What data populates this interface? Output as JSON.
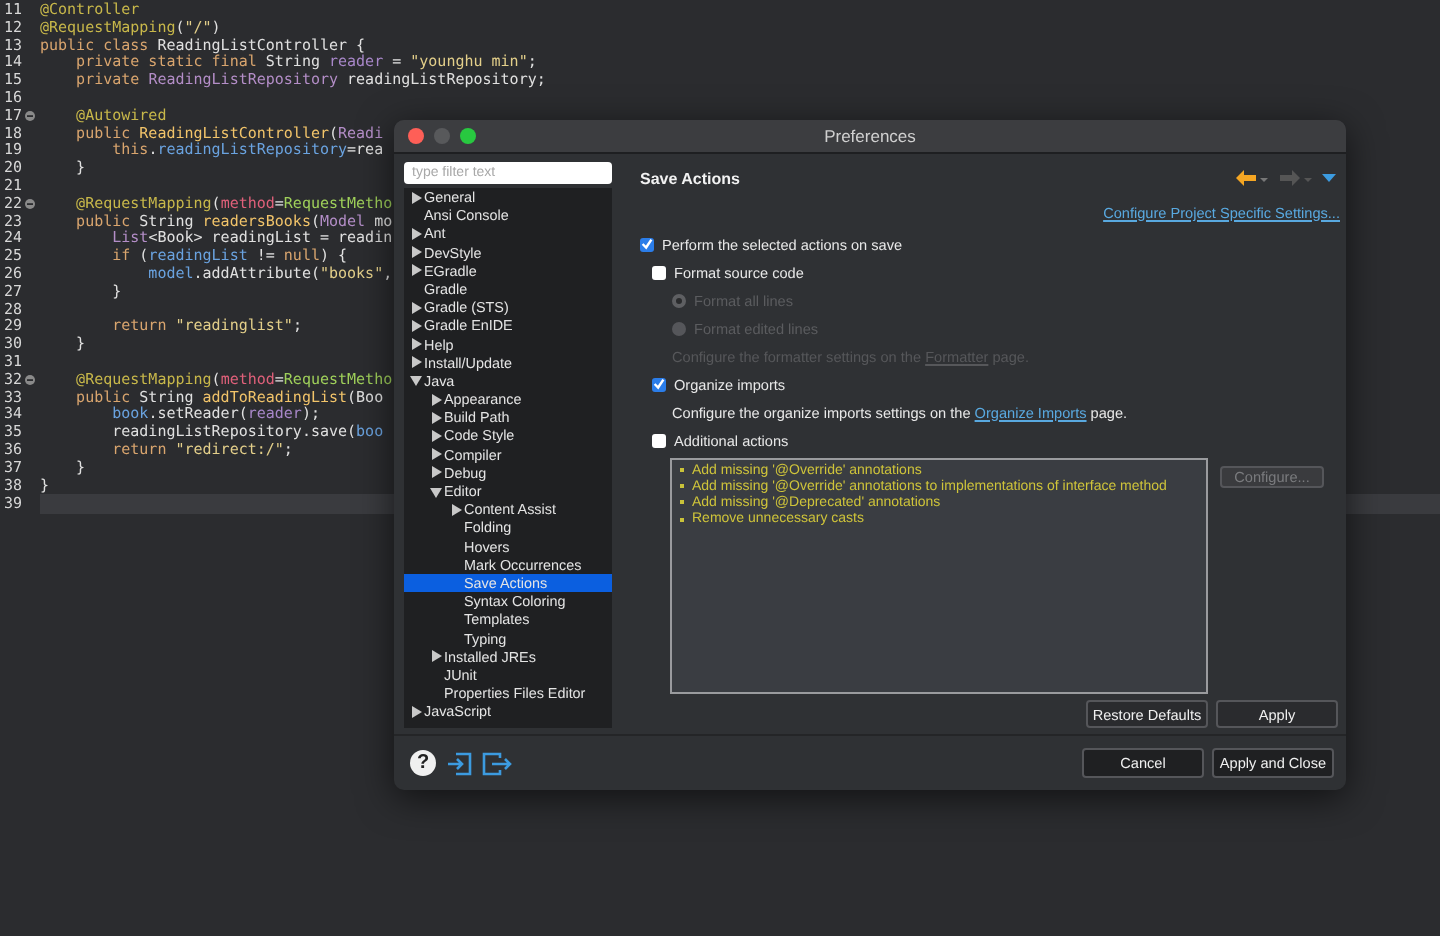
{
  "editor": {
    "lines": [
      {
        "number": "11",
        "fold": false,
        "current": false,
        "tokens": [
          {
            "text": "@Controller",
            "kind": "annotation"
          }
        ]
      },
      {
        "number": "12",
        "fold": false,
        "current": false,
        "tokens": [
          {
            "text": "@RequestMapping",
            "kind": "annotation"
          },
          {
            "text": "(",
            "kind": "plain"
          },
          {
            "text": "\"/\"",
            "kind": "string"
          },
          {
            "text": ")",
            "kind": "plain"
          }
        ]
      },
      {
        "number": "13",
        "fold": false,
        "current": false,
        "tokens": [
          {
            "text": "public class ",
            "kind": "keyword"
          },
          {
            "text": "ReadingListController {",
            "kind": "plain"
          }
        ]
      },
      {
        "number": "14",
        "fold": false,
        "current": false,
        "tokens": [
          {
            "text": "    private static final ",
            "kind": "keyword"
          },
          {
            "text": "String ",
            "kind": "plain"
          },
          {
            "text": "reader",
            "kind": "field"
          },
          {
            "text": " = ",
            "kind": "plain"
          },
          {
            "text": "\"younghu min\"",
            "kind": "string"
          },
          {
            "text": ";",
            "kind": "plain"
          }
        ]
      },
      {
        "number": "15",
        "fold": false,
        "current": false,
        "tokens": [
          {
            "text": "    private ",
            "kind": "keyword"
          },
          {
            "text": "ReadingListRepository",
            "kind": "class"
          },
          {
            "text": " readingListRepository;",
            "kind": "plain"
          }
        ]
      },
      {
        "number": "16",
        "fold": false,
        "current": false
      },
      {
        "number": "17",
        "fold": true,
        "current": false,
        "tokens": [
          {
            "text": "    @Autowired",
            "kind": "annotation"
          }
        ]
      },
      {
        "number": "18",
        "fold": false,
        "current": false,
        "tokens": [
          {
            "text": "    public ",
            "kind": "keyword"
          },
          {
            "text": "ReadingListController",
            "kind": "method"
          },
          {
            "text": "(",
            "kind": "plain"
          },
          {
            "text": "Readi",
            "kind": "class"
          }
        ]
      },
      {
        "number": "19",
        "fold": false,
        "current": false,
        "tokens": [
          {
            "text": "        this",
            "kind": "keyword"
          },
          {
            "text": ".",
            "kind": "plain"
          },
          {
            "text": "readingListRepository",
            "kind": "variable"
          },
          {
            "text": "=rea",
            "kind": "plain"
          }
        ]
      },
      {
        "number": "20",
        "fold": false,
        "current": false,
        "tokens": [
          {
            "text": "    }",
            "kind": "plain"
          }
        ]
      },
      {
        "number": "21",
        "fold": false,
        "current": false
      },
      {
        "number": "22",
        "fold": true,
        "current": false,
        "tokens": [
          {
            "text": "    @RequestMapping",
            "kind": "annotation"
          },
          {
            "text": "(",
            "kind": "plain"
          },
          {
            "text": "method",
            "kind": "attribute"
          },
          {
            "text": "=",
            "kind": "plain"
          },
          {
            "text": "RequestMetho",
            "kind": "enum"
          }
        ]
      },
      {
        "number": "23",
        "fold": false,
        "current": false,
        "tokens": [
          {
            "text": "    public ",
            "kind": "keyword"
          },
          {
            "text": "String ",
            "kind": "plain"
          },
          {
            "text": "readersBooks",
            "kind": "method"
          },
          {
            "text": "(",
            "kind": "plain"
          },
          {
            "text": "Model",
            "kind": "class"
          },
          {
            "text": " mo",
            "kind": "plain"
          }
        ]
      },
      {
        "number": "24",
        "fold": false,
        "current": false,
        "tokens": [
          {
            "text": "        List",
            "kind": "class"
          },
          {
            "text": "<Book> readingList = readin",
            "kind": "plain"
          }
        ]
      },
      {
        "number": "25",
        "fold": false,
        "current": false,
        "tokens": [
          {
            "text": "        if ",
            "kind": "keyword"
          },
          {
            "text": "(",
            "kind": "plain"
          },
          {
            "text": "readingList",
            "kind": "variable"
          },
          {
            "text": " != ",
            "kind": "plain"
          },
          {
            "text": "null",
            "kind": "keyword"
          },
          {
            "text": ") {",
            "kind": "plain"
          }
        ]
      },
      {
        "number": "26",
        "fold": false,
        "current": false,
        "tokens": [
          {
            "text": "            model",
            "kind": "variable"
          },
          {
            "text": ".addAttribute(",
            "kind": "plain"
          },
          {
            "text": "\"books\"",
            "kind": "string"
          },
          {
            "text": ",",
            "kind": "plain"
          }
        ]
      },
      {
        "number": "27",
        "fold": false,
        "current": false,
        "tokens": [
          {
            "text": "        }",
            "kind": "plain"
          }
        ]
      },
      {
        "number": "28",
        "fold": false,
        "current": false
      },
      {
        "number": "29",
        "fold": false,
        "current": false,
        "tokens": [
          {
            "text": "        return ",
            "kind": "keyword"
          },
          {
            "text": "\"readinglist\"",
            "kind": "string"
          },
          {
            "text": ";",
            "kind": "plain"
          }
        ]
      },
      {
        "number": "30",
        "fold": false,
        "current": false,
        "tokens": [
          {
            "text": "    }",
            "kind": "plain"
          }
        ]
      },
      {
        "number": "31",
        "fold": false,
        "current": false
      },
      {
        "number": "32",
        "fold": true,
        "current": false,
        "tokens": [
          {
            "text": "    @RequestMapping",
            "kind": "annotation"
          },
          {
            "text": "(",
            "kind": "plain"
          },
          {
            "text": "method",
            "kind": "attribute"
          },
          {
            "text": "=",
            "kind": "plain"
          },
          {
            "text": "RequestMetho",
            "kind": "enum"
          }
        ]
      },
      {
        "number": "33",
        "fold": false,
        "current": false,
        "tokens": [
          {
            "text": "    public ",
            "kind": "keyword"
          },
          {
            "text": "String ",
            "kind": "plain"
          },
          {
            "text": "addToReadingList",
            "kind": "method"
          },
          {
            "text": "(Boo",
            "kind": "plain"
          }
        ]
      },
      {
        "number": "34",
        "fold": false,
        "current": false,
        "tokens": [
          {
            "text": "        book",
            "kind": "variable"
          },
          {
            "text": ".setReader(",
            "kind": "plain"
          },
          {
            "text": "reader",
            "kind": "field"
          },
          {
            "text": ");",
            "kind": "plain"
          }
        ]
      },
      {
        "number": "35",
        "fold": false,
        "current": false,
        "tokens": [
          {
            "text": "        readingListRepository.save(",
            "kind": "plain"
          },
          {
            "text": "boo",
            "kind": "variable"
          }
        ]
      },
      {
        "number": "36",
        "fold": false,
        "current": false,
        "tokens": [
          {
            "text": "        return ",
            "kind": "keyword"
          },
          {
            "text": "\"redirect:/\"",
            "kind": "string"
          },
          {
            "text": ";",
            "kind": "plain"
          }
        ]
      },
      {
        "number": "37",
        "fold": false,
        "current": false,
        "tokens": [
          {
            "text": "    }",
            "kind": "plain"
          }
        ]
      },
      {
        "number": "38",
        "fold": false,
        "current": false,
        "tokens": [
          {
            "text": "}",
            "kind": "plain"
          }
        ]
      },
      {
        "number": "39",
        "fold": false,
        "current": true
      }
    ]
  },
  "dialog": {
    "title": "Preferences",
    "filter": {
      "placeholder": "type filter text"
    },
    "tree": [
      {
        "label": "General",
        "kind": "branch",
        "expanded": false,
        "selected": false
      },
      {
        "label": "Ansi Console",
        "kind": "leaf",
        "selected": false
      },
      {
        "label": "Ant",
        "kind": "branch",
        "expanded": false,
        "selected": false
      },
      {
        "label": "DevStyle",
        "kind": "branch",
        "expanded": false,
        "selected": false
      },
      {
        "label": "EGradle",
        "kind": "branch",
        "expanded": false,
        "selected": false
      },
      {
        "label": "Gradle",
        "kind": "leaf",
        "selected": false
      },
      {
        "label": "Gradle (STS)",
        "kind": "branch",
        "expanded": false,
        "selected": false
      },
      {
        "label": "Gradle EnIDE",
        "kind": "branch",
        "expanded": false,
        "selected": false
      },
      {
        "label": "Help",
        "kind": "branch",
        "expanded": false,
        "selected": false
      },
      {
        "label": "Install/Update",
        "kind": "branch",
        "expanded": false,
        "selected": false
      },
      {
        "label": "Java",
        "kind": "branch",
        "expanded": true,
        "selected": false,
        "children": [
          {
            "label": "Appearance",
            "kind": "branch",
            "expanded": false,
            "selected": false
          },
          {
            "label": "Build Path",
            "kind": "branch",
            "expanded": false,
            "selected": false
          },
          {
            "label": "Code Style",
            "kind": "branch",
            "expanded": false,
            "selected": false
          },
          {
            "label": "Compiler",
            "kind": "branch",
            "expanded": false,
            "selected": false
          },
          {
            "label": "Debug",
            "kind": "branch",
            "expanded": false,
            "selected": false
          },
          {
            "label": "Editor",
            "kind": "branch",
            "expanded": true,
            "selected": false,
            "children": [
              {
                "label": "Content Assist",
                "kind": "branch",
                "expanded": false,
                "selected": false
              },
              {
                "label": "Folding",
                "kind": "leaf",
                "selected": false
              },
              {
                "label": "Hovers",
                "kind": "leaf",
                "selected": false
              },
              {
                "label": "Mark Occurrences",
                "kind": "leaf",
                "selected": false
              },
              {
                "label": "Save Actions",
                "kind": "leaf",
                "selected": true
              },
              {
                "label": "Syntax Coloring",
                "kind": "leaf",
                "selected": false
              },
              {
                "label": "Templates",
                "kind": "leaf",
                "selected": false
              },
              {
                "label": "Typing",
                "kind": "leaf",
                "selected": false
              }
            ]
          },
          {
            "label": "Installed JREs",
            "kind": "branch",
            "expanded": false,
            "selected": false
          },
          {
            "label": "JUnit",
            "kind": "leaf",
            "selected": false
          },
          {
            "label": "Properties Files Editor",
            "kind": "leaf",
            "selected": false
          }
        ]
      },
      {
        "label": "JavaScript",
        "kind": "branch",
        "expanded": false,
        "selected": false
      }
    ],
    "page": {
      "title": "Save Actions",
      "link": "Configure Project Specific Settings...",
      "options": [
        {
          "kind": "checkbox",
          "label": "Perform the selected actions on save",
          "checked": true,
          "disabled": false,
          "children": [
            {
              "kind": "checkbox",
              "label": "Format source code",
              "checked": false,
              "disabled": false,
              "children": [
                {
                  "kind": "radio",
                  "label": "Format all lines",
                  "selected": true,
                  "disabled": true
                },
                {
                  "kind": "radio",
                  "label": "Format edited lines",
                  "selected": false,
                  "disabled": true
                },
                {
                  "kind": "note",
                  "before": "Configure the formatter settings on the ",
                  "link": "Formatter",
                  "after": " page.",
                  "disabled": true
                }
              ]
            },
            {
              "kind": "checkbox",
              "label": "Organize imports",
              "checked": true,
              "disabled": false,
              "children": [
                {
                  "kind": "note",
                  "before": "Configure the organize imports settings on the ",
                  "link": "Organize Imports",
                  "after": " page.",
                  "disabled": false
                }
              ]
            },
            {
              "kind": "checkbox",
              "label": "Additional actions",
              "checked": false,
              "disabled": false,
              "children": [
                {
                  "kind": "actions",
                  "items": [
                    "Add missing '@Override' annotations",
                    "Add missing '@Override' annotations to implementations of interface method",
                    "Add missing '@Deprecated' annotations",
                    "Remove unnecessary casts"
                  ],
                  "button": {
                    "label": "Configure...",
                    "disabled": true
                  }
                }
              ]
            }
          ]
        }
      ],
      "buttons": [
        {
          "label": "Restore Defaults"
        },
        {
          "label": "Apply"
        }
      ]
    },
    "help": "?",
    "footer_buttons": [
      {
        "label": "Cancel"
      },
      {
        "label": "Apply and Close"
      }
    ]
  }
}
